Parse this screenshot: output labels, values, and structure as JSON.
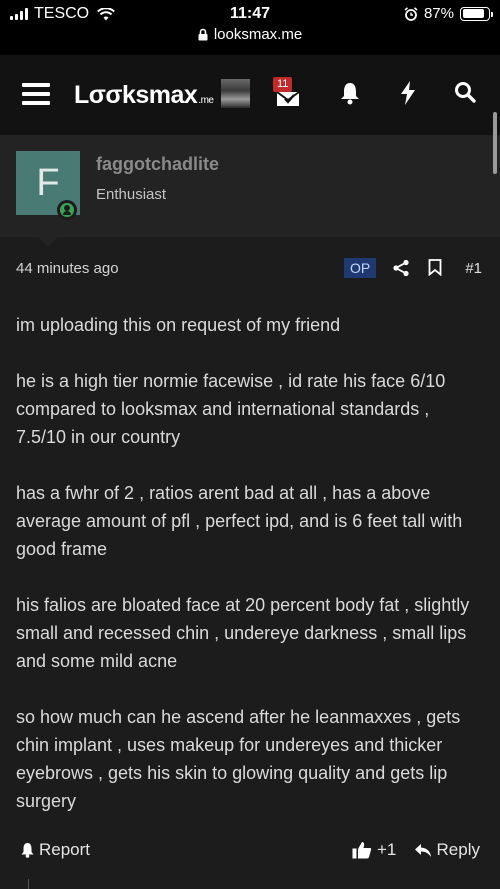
{
  "status_bar": {
    "carrier": "TESCO",
    "time": "11:47",
    "url": "looksmax.me",
    "battery": "87%",
    "battery_level": 0.87
  },
  "navbar": {
    "logo": "Lσσksmax",
    "logo_suffix": ".me",
    "inbox_count": "11",
    "icons": [
      "menu-icon",
      "inbox-icon",
      "bell-icon",
      "lightning-icon",
      "search-icon"
    ]
  },
  "post": {
    "author": {
      "avatar_letter": "F",
      "avatar_color": "#4a7a74",
      "username": "faggotchadlite",
      "title": "Enthusiast"
    },
    "time": "44 minutes ago",
    "op_label": "OP",
    "number": "#1",
    "paragraphs": [
      "im uploading this on request of my friend",
      "he is a high tier normie facewise , id rate his face 6/10 compared to looksmax and international standards , 7.5/10 in our country",
      "has a fwhr of 2 , ratios arent bad at all , has a above average amount of pfl , perfect ipd, and is 6 feet tall with good frame",
      "his falios are bloated face at 20 percent body fat , slightly small and recessed chin , undereye darkness , small lips and some mild acne",
      "so how much can he ascend after he leanmaxxes , gets chin implant , uses makeup for undereyes and thicker eyebrows , gets his skin to glowing quality and gets lip surgery"
    ],
    "footer": {
      "report_label": "Report",
      "like_label": "+1",
      "reply_label": "Reply"
    }
  }
}
